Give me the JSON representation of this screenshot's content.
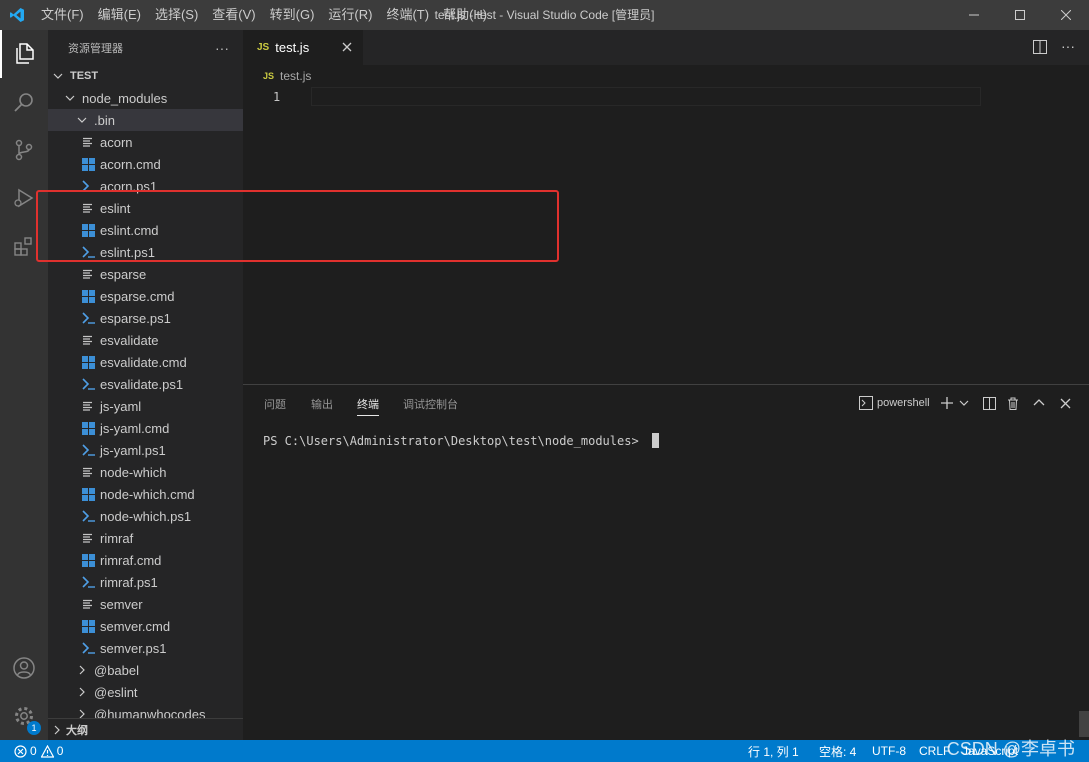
{
  "window": {
    "title": "test.js - test - Visual Studio Code [管理员]",
    "menus": [
      "文件(F)",
      "编辑(E)",
      "选择(S)",
      "查看(V)",
      "转到(G)",
      "运行(R)",
      "终端(T)",
      "帮助(H)"
    ]
  },
  "sidebar": {
    "title": "资源管理器",
    "more": "···",
    "root": "TEST",
    "folder": "node_modules",
    "subfolder": ".bin",
    "files": [
      {
        "name": "acorn",
        "type": "file"
      },
      {
        "name": "acorn.cmd",
        "type": "cmd"
      },
      {
        "name": "acorn.ps1",
        "type": "ps1"
      },
      {
        "name": "eslint",
        "type": "file"
      },
      {
        "name": "eslint.cmd",
        "type": "cmd"
      },
      {
        "name": "eslint.ps1",
        "type": "ps1"
      },
      {
        "name": "esparse",
        "type": "file"
      },
      {
        "name": "esparse.cmd",
        "type": "cmd"
      },
      {
        "name": "esparse.ps1",
        "type": "ps1"
      },
      {
        "name": "esvalidate",
        "type": "file"
      },
      {
        "name": "esvalidate.cmd",
        "type": "cmd"
      },
      {
        "name": "esvalidate.ps1",
        "type": "ps1"
      },
      {
        "name": "js-yaml",
        "type": "file"
      },
      {
        "name": "js-yaml.cmd",
        "type": "cmd"
      },
      {
        "name": "js-yaml.ps1",
        "type": "ps1"
      },
      {
        "name": "node-which",
        "type": "file"
      },
      {
        "name": "node-which.cmd",
        "type": "cmd"
      },
      {
        "name": "node-which.ps1",
        "type": "ps1"
      },
      {
        "name": "rimraf",
        "type": "file"
      },
      {
        "name": "rimraf.cmd",
        "type": "cmd"
      },
      {
        "name": "rimraf.ps1",
        "type": "ps1"
      },
      {
        "name": "semver",
        "type": "file"
      },
      {
        "name": "semver.cmd",
        "type": "cmd"
      },
      {
        "name": "semver.ps1",
        "type": "ps1"
      }
    ],
    "folders_after": [
      "@babel",
      "@eslint",
      "@humanwhocodes"
    ],
    "outline": "大纲"
  },
  "editor": {
    "tab_label": "test.js",
    "tab_icon": "JS",
    "breadcrumb": "test.js",
    "line_number": "1"
  },
  "panel": {
    "tabs": [
      "问题",
      "输出",
      "终端",
      "调试控制台"
    ],
    "active_tab": "终端",
    "shell": "powershell",
    "terminal_line": "PS C:\\Users\\Administrator\\Desktop\\test\\node_modules> "
  },
  "activity": {
    "settings_badge": "1"
  },
  "statusbar": {
    "errors": "0",
    "warnings": "0",
    "position": "行 1, 列 1",
    "spaces": "空格: 4",
    "encoding": "UTF-8",
    "eol": "CRLF",
    "language": "JavaScript"
  },
  "watermark": "CSDN @李卓书",
  "colors": {
    "accent": "#007acc",
    "annotation": "#e0312e",
    "js_yellow": "#cbcb41",
    "cmd_blue": "#3c8fd6",
    "ps1_blue": "#4f9fe6"
  }
}
